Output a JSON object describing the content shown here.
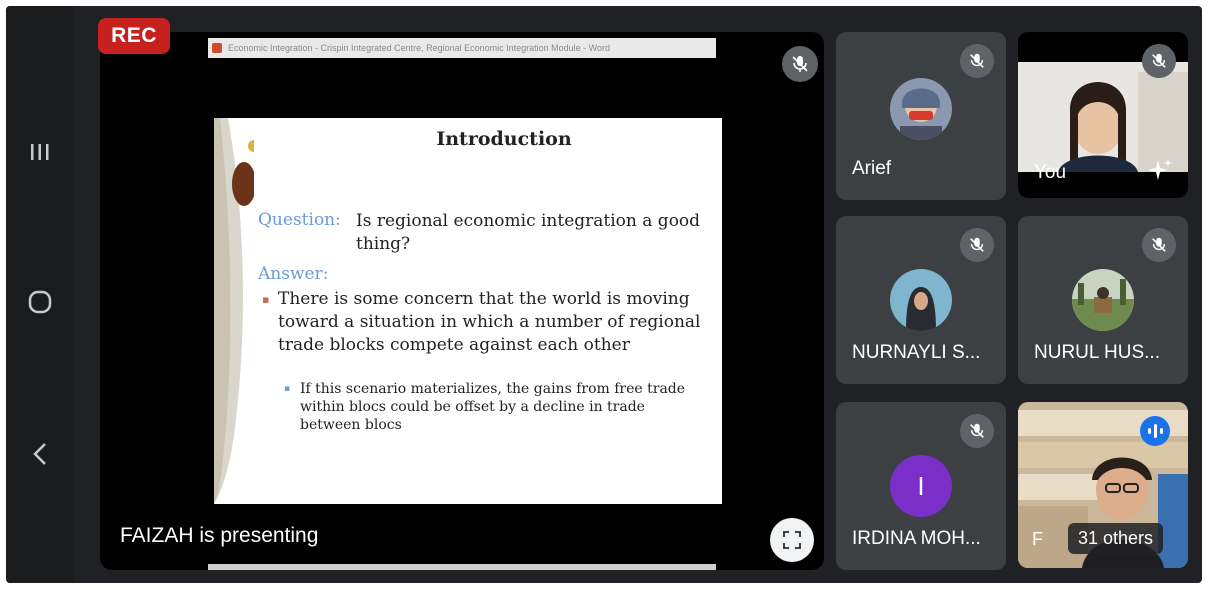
{
  "recording": {
    "label": "REC"
  },
  "presentation": {
    "browser_tab_text": "Economic Integration - Crispin Integrated Centre, Regional Economic Integration Module - Word",
    "slide": {
      "title": "Introduction",
      "question_label": "Question:",
      "question_text": "Is regional economic integration a good thing?",
      "answer_label": "Answer:",
      "bullet_main": "There is some concern that the world is moving toward a situation in which a number of regional trade blocks compete against each other",
      "bullet_sub": "If this scenario materializes, the gains from free trade within blocs could be offset by a decline in trade between blocs"
    },
    "presenter_status": "FAIZAH is presenting",
    "presenter_muted": true
  },
  "participants": [
    {
      "name": "Arief",
      "muted": true,
      "avatar": "photo-avatar"
    },
    {
      "name": "You",
      "muted": true,
      "avatar": "camera-video"
    },
    {
      "name": "NURNAYLI S...",
      "muted": true,
      "avatar": "photo-avatar"
    },
    {
      "name": "NURUL HUS...",
      "muted": true,
      "avatar": "photo-avatar"
    },
    {
      "name": "IRDINA MOH...",
      "muted": true,
      "avatar_letter": "I",
      "avatar_color": "#7b2ec8"
    },
    {
      "name": "F",
      "others_count": "31 others",
      "speaking": true
    }
  ],
  "colors": {
    "rec": "#c5221f",
    "tile_bg": "#3c4043",
    "accent_blue": "#1a73e8",
    "slide_label_blue": "#6b9ad8"
  },
  "icons": [
    "recents-icon",
    "home-icon",
    "back-icon",
    "mic-off-icon",
    "fullscreen-icon",
    "sparkle-effects-icon",
    "speaking-indicator-icon"
  ]
}
